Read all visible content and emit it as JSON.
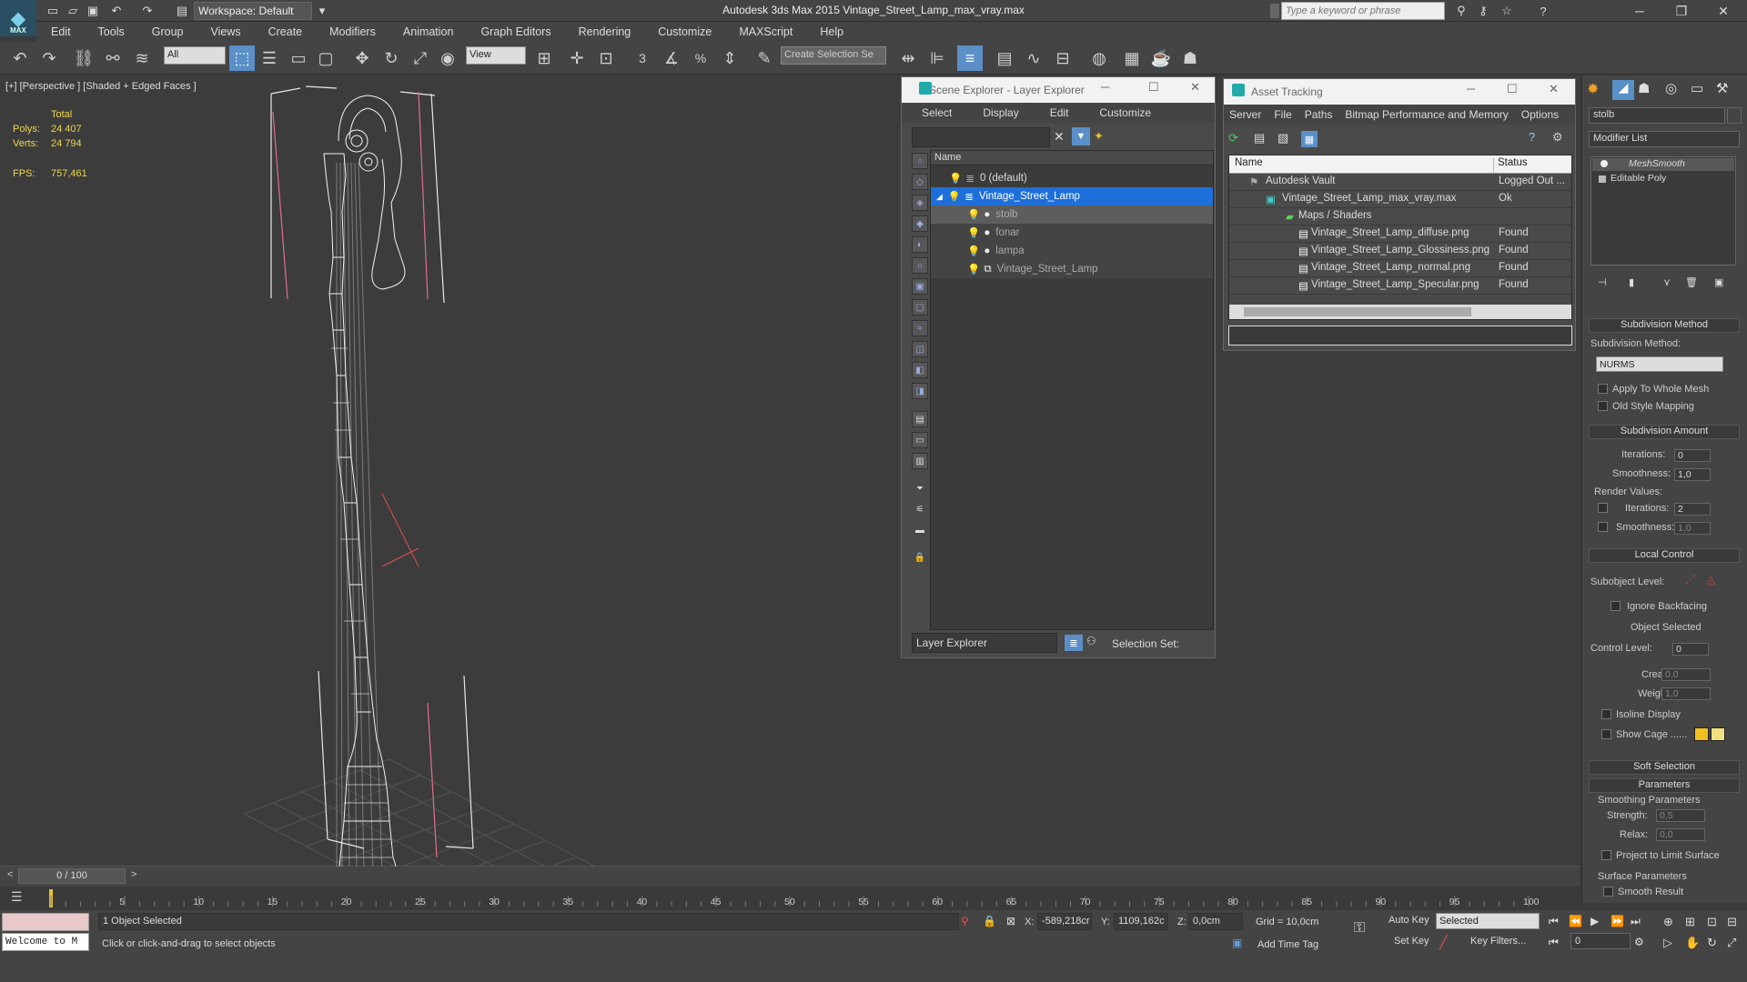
{
  "app": {
    "logo_text": "MAX",
    "workspace": "Workspace: Default",
    "title": "Autodesk 3ds Max  2015    Vintage_Street_Lamp_max_vray.max",
    "search_placeholder": "Type a keyword or phrase"
  },
  "menu": [
    "Edit",
    "Tools",
    "Group",
    "Views",
    "Create",
    "Modifiers",
    "Animation",
    "Graph Editors",
    "Rendering",
    "Customize",
    "MAXScript",
    "Help"
  ],
  "toolbar": {
    "filter": "All",
    "ref_coord": "View",
    "selection_set": "Create Selection Se",
    "snap_3": "3",
    "snap_pct": "%"
  },
  "viewport": {
    "label": "[+] [Perspective ] [Shaded + Edged Faces ]",
    "total_label": "Total",
    "polys_label": "Polys:",
    "polys": "24 407",
    "verts_label": "Verts:",
    "verts": "24 794",
    "fps_label": "FPS:",
    "fps": "757,461"
  },
  "scene_explorer": {
    "title": "Scene Explorer - Layer Explorer",
    "menus": [
      "Select",
      "Display",
      "Edit",
      "Customize"
    ],
    "column": "Name",
    "rows": [
      {
        "name": "0 (default)",
        "level": 0,
        "selected": false
      },
      {
        "name": "Vintage_Street_Lamp",
        "level": 0,
        "selected": true
      },
      {
        "name": "stolb",
        "level": 1,
        "selected": false
      },
      {
        "name": "fonar",
        "level": 1,
        "selected": false
      },
      {
        "name": "lampa",
        "level": 1,
        "selected": false
      },
      {
        "name": "Vintage_Street_Lamp",
        "level": 1,
        "selected": false
      }
    ],
    "footer_mode": "Layer Explorer",
    "selection_set_label": "Selection Set:"
  },
  "asset_tracking": {
    "title": "Asset Tracking",
    "menus": [
      "Server",
      "File",
      "Paths",
      "Bitmap Performance and Memory",
      "Options"
    ],
    "col_name": "Name",
    "col_status": "Status",
    "rows": [
      {
        "name": "Autodesk Vault",
        "status": "Logged Out ...",
        "indent": 1
      },
      {
        "name": "Vintage_Street_Lamp_max_vray.max",
        "status": "Ok",
        "indent": 2
      },
      {
        "name": "Maps / Shaders",
        "status": "",
        "indent": 3
      },
      {
        "name": "Vintage_Street_Lamp_diffuse.png",
        "status": "Found",
        "indent": 4
      },
      {
        "name": "Vintage_Street_Lamp_Glossiness.png",
        "status": "Found",
        "indent": 4
      },
      {
        "name": "Vintage_Street_Lamp_normal.png",
        "status": "Found",
        "indent": 4
      },
      {
        "name": "Vintage_Street_Lamp_Specular.png",
        "status": "Found",
        "indent": 4
      }
    ]
  },
  "command_panel": {
    "object_name": "stolb",
    "modifier_list": "Modifier List",
    "stack": [
      "MeshSmooth",
      "Editable Poly"
    ],
    "subdivision_method_title": "Subdivision Method",
    "subdivision_method_label": "Subdivision Method:",
    "subdivision_method_value": "NURMS",
    "apply_whole_mesh": "Apply To Whole Mesh",
    "old_style_mapping": "Old Style Mapping",
    "subdivision_amount_title": "Subdivision Amount",
    "iterations_label": "Iterations:",
    "iterations": "0",
    "smoothness_label": "Smoothness:",
    "smoothness": "1,0",
    "render_values": "Render Values:",
    "render_iterations": "2",
    "render_smoothness": "1,0",
    "local_control_title": "Local Control",
    "subobject_level": "Subobject Level:",
    "ignore_backfacing": "Ignore Backfacing",
    "object_selected": "Object Selected",
    "control_level_label": "Control Level:",
    "control_level": "0",
    "crease_label": "Crease:",
    "crease": "0,0",
    "weight_label": "Weight:",
    "weight": "1,0",
    "isoline_display": "Isoline Display",
    "show_cage": "Show Cage ......",
    "soft_selection_title": "Soft Selection",
    "parameters_title": "Parameters",
    "smoothing_params": "Smoothing Parameters",
    "strength_label": "Strength:",
    "strength": "0,5",
    "relax_label": "Relax:",
    "relax": "0,0",
    "project_limit": "Project to Limit Surface",
    "surface_params": "Surface Parameters",
    "smooth_result": "Smooth Result",
    "cage_color_1": "#f0c020",
    "cage_color_2": "#f0e080"
  },
  "timeline": {
    "frame": "0 / 100",
    "ticks": [
      "5",
      "10",
      "15",
      "20",
      "25",
      "30",
      "35",
      "40",
      "45",
      "50",
      "55",
      "60",
      "65",
      "70",
      "75",
      "80",
      "85",
      "90",
      "95",
      "100"
    ]
  },
  "status": {
    "maxscript": "Welcome to M",
    "selected": "1 Object Selected",
    "prompt": "Click or click-and-drag to select objects",
    "x_label": "X:",
    "x": "-589,218cr",
    "y_label": "Y:",
    "y": "1109,162c",
    "z_label": "Z:",
    "z": "0,0cm",
    "grid": "Grid = 10,0cm",
    "add_time_tag": "Add Time Tag",
    "auto_key": "Auto Key",
    "set_key": "Set Key",
    "key_mode": "Selected",
    "key_filters": "Key Filters...",
    "current_frame": "0"
  }
}
